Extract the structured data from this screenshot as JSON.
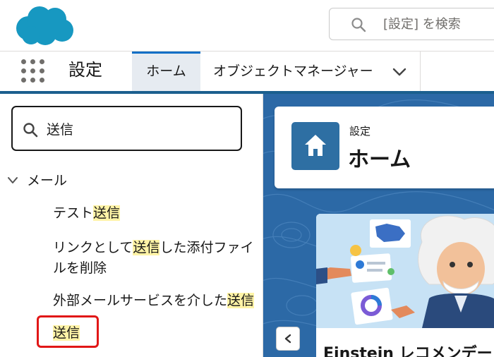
{
  "header": {
    "search_placeholder": "[設定] を検索"
  },
  "context_bar": {
    "app_name": "設定",
    "tabs": [
      {
        "label": "ホーム",
        "active": true
      },
      {
        "label": "オブジェクトマネージャー",
        "active": false
      }
    ]
  },
  "sidebar": {
    "quick_find_value": "送信",
    "group": {
      "label": "メール",
      "expanded": true
    },
    "items": [
      {
        "before": "テスト",
        "match": "送信",
        "after": ""
      },
      {
        "before": "リンクとして",
        "match": "送信",
        "after": "した添付ファイ"
      },
      {
        "before": "ルを削除",
        "match": "",
        "after": ""
      },
      {
        "before": "外部メールサービスを介した",
        "match": "送信",
        "after": ""
      },
      {
        "before": "",
        "match": "送信",
        "after": ""
      }
    ]
  },
  "main": {
    "eyebrow": "設定",
    "title": "ホーム",
    "card_title": "Einstein レコメンデー"
  },
  "colors": {
    "brand_blue": "#1b5f8e",
    "highlight": "#fff3a6",
    "selection_outline": "#e11717",
    "home_tile": "#2e6fa3"
  },
  "icons": [
    "salesforce-cloud-logo",
    "search-icon",
    "app-launcher-icon",
    "chevron-down-icon",
    "home-icon",
    "chevron-left-icon"
  ]
}
